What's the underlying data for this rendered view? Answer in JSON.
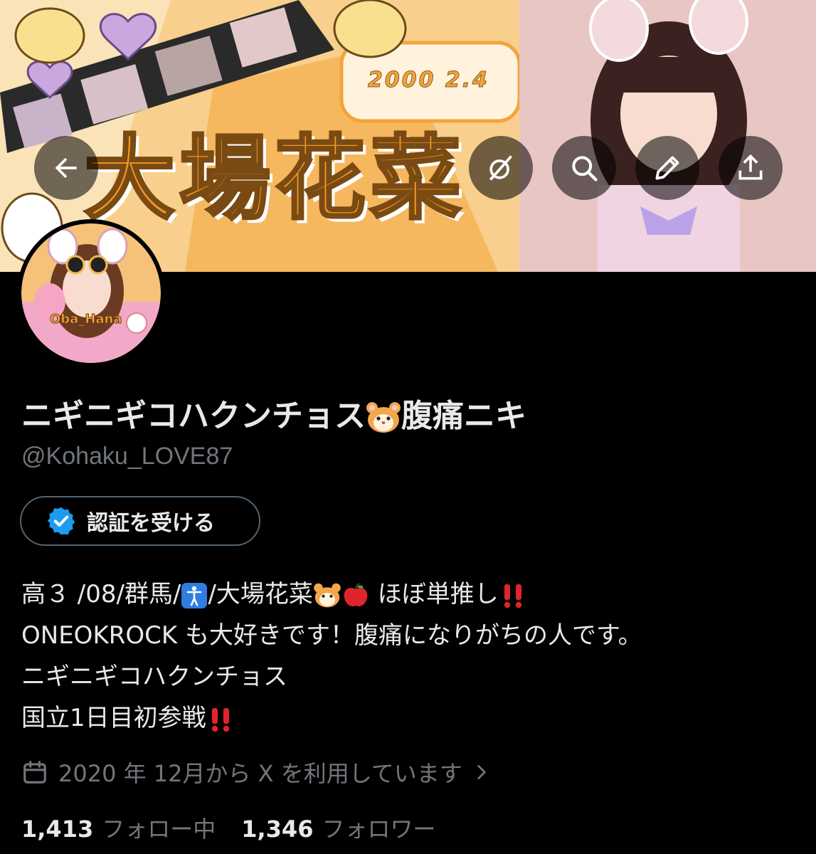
{
  "banner": {
    "title": "大場花菜",
    "date": "2000 2.4",
    "colors": {
      "primary": "#f39a23",
      "background": "#f5c173"
    }
  },
  "nav": {
    "back_icon": "arrow-left-icon",
    "grok_icon": "grok-icon",
    "search_icon": "search-icon",
    "edit_icon": "pencil-icon",
    "share_icon": "share-icon"
  },
  "avatar": {
    "text": "Oba_Hana"
  },
  "profile": {
    "display_name": "ニギニギコハクンチョス",
    "display_name_suffix": "腹痛ニキ",
    "handle": "@Kohaku_LOVE87",
    "verify_label": "認証を受ける",
    "verify_color": "#1d9bf0"
  },
  "bio": {
    "line1_a": "高３ /08/群馬/",
    "line1_b": "/大場花菜",
    "line1_c": " ほぼ単推し",
    "line2": "ONEOKROCK も大好きです！腹痛になりがちの人です。",
    "line3": "ニギニギコハクンチョス",
    "line4": "国立1日目初参戦"
  },
  "joined": {
    "text": "2020 年 12月から X を利用しています"
  },
  "stats": {
    "following_count": "1,413",
    "following_label": "フォロー中",
    "followers_count": "1,346",
    "followers_label": "フォロワー"
  }
}
